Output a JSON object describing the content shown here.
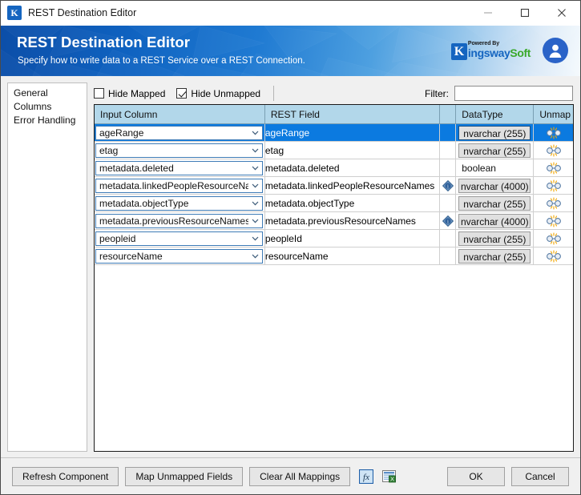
{
  "window": {
    "title": "REST Destination Editor",
    "app_icon": "K",
    "controls": {
      "minimize": "minimize-icon",
      "maximize": "maximize-icon",
      "close": "close-icon"
    }
  },
  "banner": {
    "title": "REST Destination Editor",
    "subtitle": "Specify how to write data to a REST Service over a REST Connection.",
    "brand": {
      "mark": "K",
      "powered_by": "Powered By",
      "name_part1": "ingsway",
      "name_part2": "Soft",
      "color1": "#1565c0",
      "color2": "#3aa92b"
    },
    "avatar": "user-avatar-icon"
  },
  "sidebar": {
    "items": [
      {
        "label": "General",
        "selected": false
      },
      {
        "label": "Columns",
        "selected": true
      },
      {
        "label": "Error Handling",
        "selected": false
      }
    ]
  },
  "toolbar": {
    "hide_mapped": {
      "label": "Hide Mapped",
      "checked": false
    },
    "hide_unmapped": {
      "label": "Hide Unmapped",
      "checked": true
    },
    "filter_label": "Filter:",
    "filter_value": "",
    "filter_placeholder": ""
  },
  "grid": {
    "columns": [
      "Input Column",
      "REST Field",
      "",
      "DataType",
      "Unmap"
    ],
    "rows": [
      {
        "input_column": "ageRange",
        "rest_field": "ageRange",
        "info": false,
        "data_type": "nvarchar (255)",
        "data_type_style": "button",
        "unmap": "unmap-icon",
        "selected": true
      },
      {
        "input_column": "etag",
        "rest_field": "etag",
        "info": false,
        "data_type": "nvarchar (255)",
        "data_type_style": "button",
        "unmap": "unmap-icon",
        "selected": false
      },
      {
        "input_column": "metadata.deleted",
        "rest_field": "metadata.deleted",
        "info": false,
        "data_type": "boolean",
        "data_type_style": "plain",
        "unmap": "unmap-icon",
        "selected": false
      },
      {
        "input_column": "metadata.linkedPeopleResourceNa...",
        "rest_field": "metadata.linkedPeopleResourceNames",
        "info": true,
        "data_type": "nvarchar (4000)",
        "data_type_style": "button",
        "unmap": "unmap-icon",
        "selected": false
      },
      {
        "input_column": "metadata.objectType",
        "rest_field": "metadata.objectType",
        "info": false,
        "data_type": "nvarchar (255)",
        "data_type_style": "button",
        "unmap": "unmap-icon",
        "selected": false
      },
      {
        "input_column": "metadata.previousResourceNames",
        "rest_field": "metadata.previousResourceNames",
        "info": true,
        "data_type": "nvarchar (4000)",
        "data_type_style": "button",
        "unmap": "unmap-icon",
        "selected": false
      },
      {
        "input_column": "peopleid",
        "rest_field": "peopleId",
        "info": false,
        "data_type": "nvarchar (255)",
        "data_type_style": "button",
        "unmap": "unmap-icon",
        "selected": false
      },
      {
        "input_column": "resourceName",
        "rest_field": "resourceName",
        "info": false,
        "data_type": "nvarchar (255)",
        "data_type_style": "button",
        "unmap": "unmap-icon",
        "selected": false
      }
    ]
  },
  "footer": {
    "refresh_component": "Refresh Component",
    "map_unmapped_fields": "Map Unmapped Fields",
    "clear_all_mappings": "Clear All Mappings",
    "expression_icon": "fx-expression-icon",
    "export_icon": "export-excel-icon",
    "ok": "OK",
    "cancel": "Cancel"
  }
}
